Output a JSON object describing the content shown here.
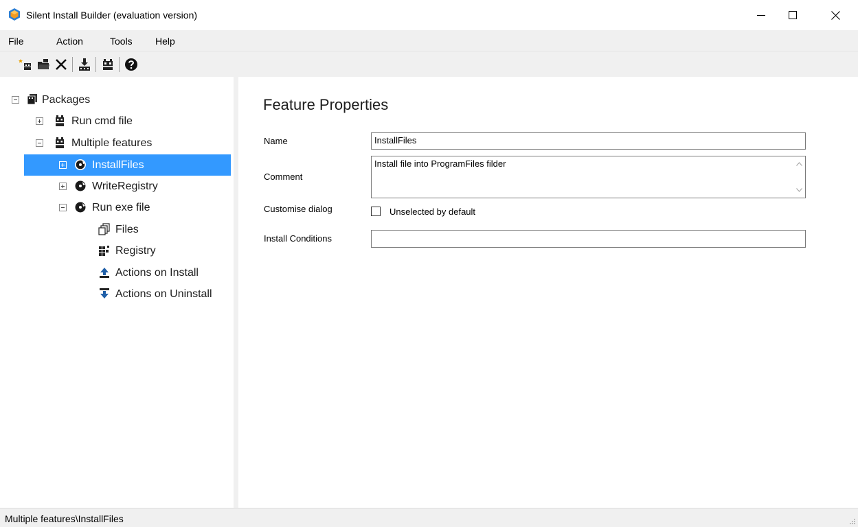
{
  "window": {
    "title": "Silent Install Builder (evaluation version)"
  },
  "menu": [
    "File",
    "Action",
    "Tools",
    "Help"
  ],
  "toolbar": {
    "buttons": [
      "new-package-icon",
      "open-package-icon",
      "delete-icon",
      "build-icon",
      "package-icon",
      "help-icon"
    ]
  },
  "tree": {
    "root": "Packages",
    "items": [
      {
        "label": "Run cmd file",
        "icon": "package-icon"
      },
      {
        "label": "Multiple features",
        "icon": "package-icon"
      },
      {
        "label": "InstallFiles",
        "icon": "feature-disc-icon"
      },
      {
        "label": "WriteRegistry",
        "icon": "feature-disc-icon"
      },
      {
        "label": "Run exe file",
        "icon": "feature-disc-icon"
      },
      {
        "label": "Files",
        "icon": "files-icon"
      },
      {
        "label": "Registry",
        "icon": "registry-icon"
      },
      {
        "label": "Actions on Install",
        "icon": "install-action-icon"
      },
      {
        "label": "Actions on Uninstall",
        "icon": "uninstall-action-icon"
      }
    ]
  },
  "properties": {
    "heading": "Feature Properties",
    "name_label": "Name",
    "name_value": "InstallFiles",
    "comment_label": "Comment",
    "comment_value": "Install file into ProgramFiles filder",
    "customise_label": "Customise dialog",
    "checkbox_label": "Unselected by default",
    "checkbox_checked": false,
    "conditions_label": "Install Conditions",
    "conditions_value": ""
  },
  "status": {
    "path": "Multiple features\\InstallFiles"
  },
  "colors": {
    "selection": "#3399ff",
    "chrome": "#f0f0f0",
    "app_icon_blue": "#2d7fd3",
    "app_icon_orange": "#f39a21"
  }
}
